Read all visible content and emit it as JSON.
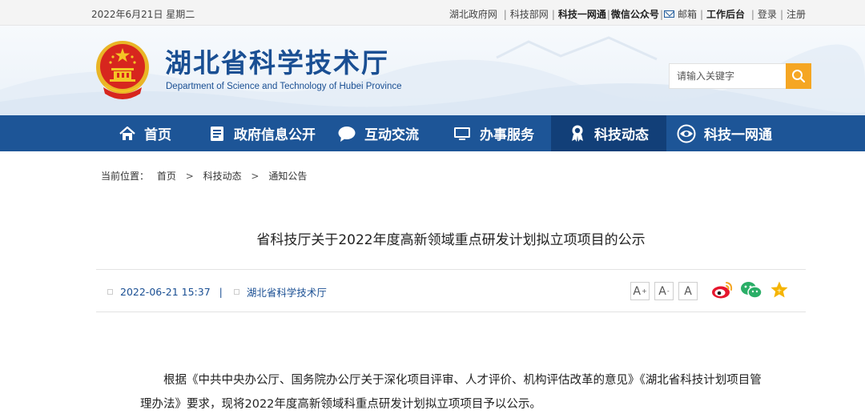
{
  "topbar": {
    "date": "2022年6月21日 星期二",
    "links": {
      "hubei_gov": "湖北政府网",
      "most": "科技部网",
      "kejiyiwangtong": "科技一网通",
      "wechat": "微信公众号",
      "mail": "邮箱",
      "backend": "工作后台",
      "login": "登录",
      "register": "注册"
    }
  },
  "header": {
    "title": "湖北省科学技术厅",
    "subtitle": "Department of Science and Technology of Hubei Province",
    "search_placeholder": "请输入关键字"
  },
  "nav": {
    "items": [
      {
        "label": "首页",
        "icon": "home-icon"
      },
      {
        "label": "政府信息公开",
        "icon": "document-list-icon"
      },
      {
        "label": "互动交流",
        "icon": "chat-bubble-icon"
      },
      {
        "label": "办事服务",
        "icon": "monitor-icon"
      },
      {
        "label": "科技动态",
        "icon": "award-medal-icon",
        "active": true
      },
      {
        "label": "科技一网通",
        "icon": "eye-icon"
      }
    ]
  },
  "breadcrumb": {
    "prefix": "当前位置：",
    "items": [
      "首页",
      "科技动态",
      "通知公告"
    ],
    "separator": ">"
  },
  "article": {
    "title": "省科技厅关于2022年度高新领域重点研发计划拟立项项目的公示",
    "datetime": "2022-06-21 15:37",
    "separator": "|",
    "source": "湖北省科学技术厅",
    "font_buttons": [
      "A",
      "A",
      "A"
    ],
    "body": "根据《中共中央办公厅、国务院办公厅关于深化项目评审、人才评价、机构评估改革的意见》《湖北省科技计划项目管理办法》要求，现将2022年度高新领域科重点研发计划拟立项项目予以公示。"
  },
  "colors": {
    "nav_bg": "#1d5597",
    "nav_active": "#123f78",
    "brand_blue": "#1a4f93",
    "search_button": "#f5a623",
    "weibo": "#e6162d",
    "wechat": "#2aae67",
    "favorite": "#f5b400"
  }
}
